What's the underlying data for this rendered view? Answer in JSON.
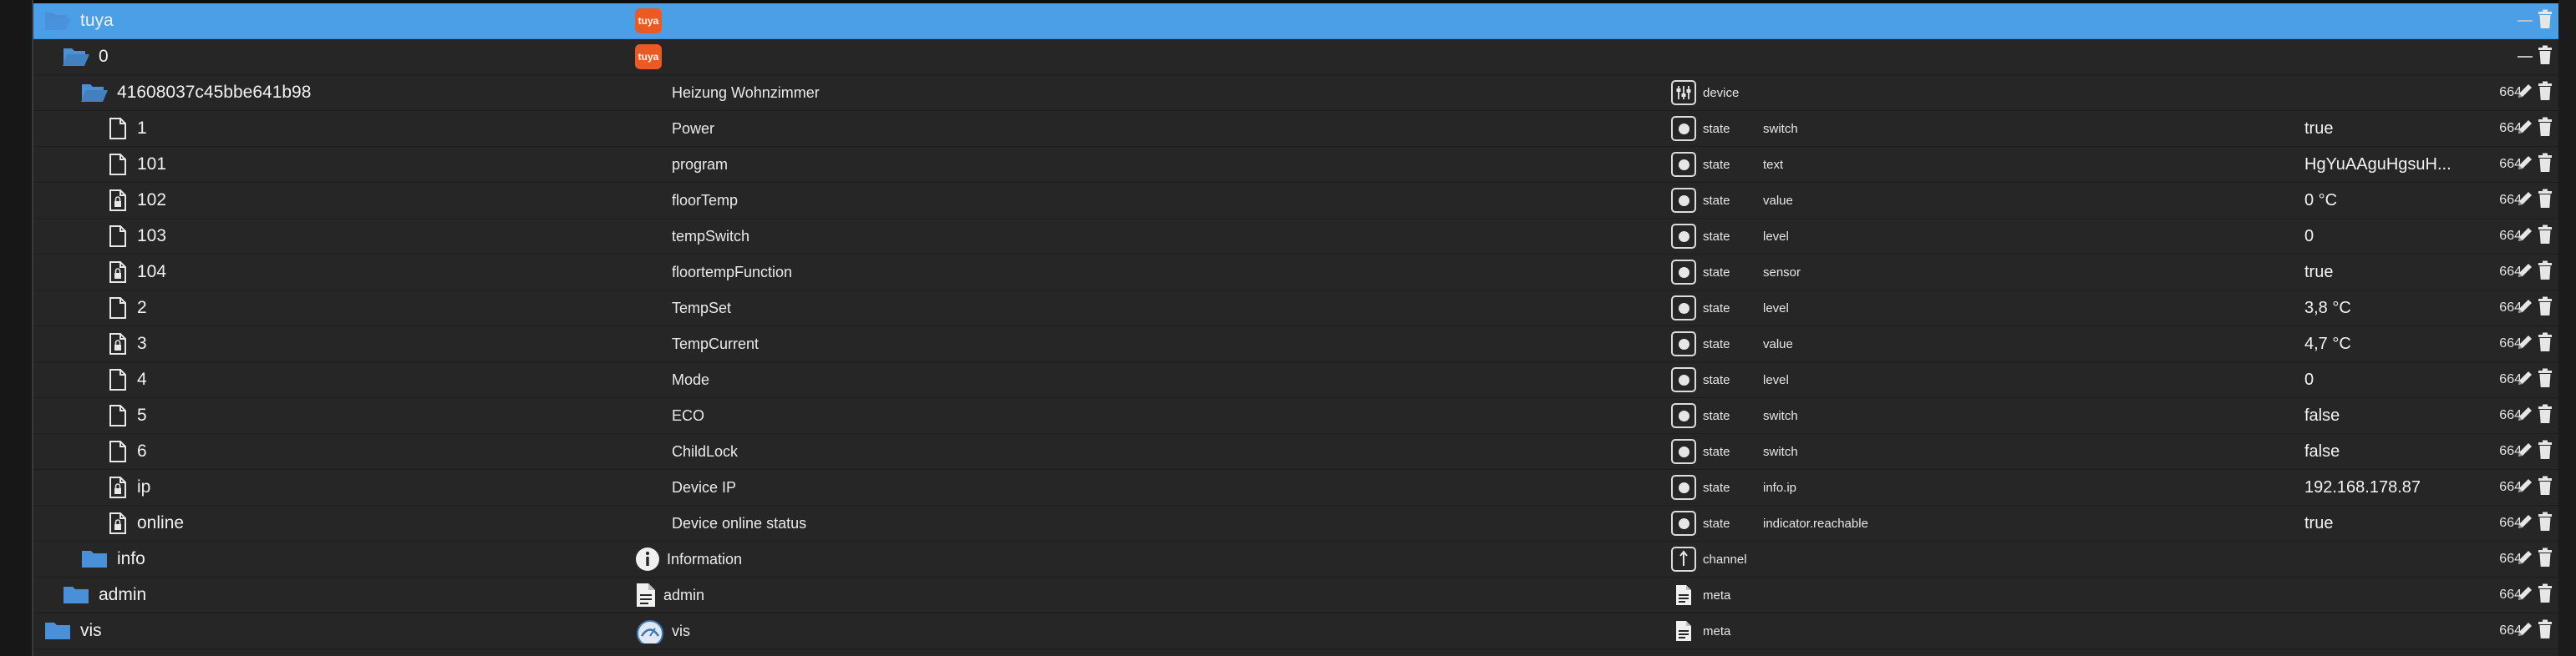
{
  "tree": {
    "rows": [
      {
        "id": "tuya",
        "name": "",
        "icon": "folder-open-icon",
        "badge": "tuya",
        "role": "",
        "type": "",
        "value": "",
        "acl": "",
        "selected": true,
        "level": 0
      },
      {
        "id": "0",
        "name": "",
        "icon": "folder-open-icon",
        "badge": "tuya",
        "role": "",
        "type": "",
        "value": "",
        "acl": "",
        "level": 1
      },
      {
        "id": "41608037c45bbe641b98",
        "name": "Heizung Wohnzimmer",
        "icon": "folder-open-icon",
        "role": "device",
        "role_icon": "device-icon",
        "type": "",
        "value": "",
        "acl": "664",
        "level": 2
      },
      {
        "id": "1",
        "name": "Power",
        "icon": "file-icon",
        "role": "state",
        "role_icon": "state-icon",
        "type": "switch",
        "value": "true",
        "acl": "664",
        "level": 3
      },
      {
        "id": "101",
        "name": "program",
        "icon": "file-icon",
        "role": "state",
        "role_icon": "state-icon",
        "type": "text",
        "value": "HgYuAAguHgsuH...",
        "acl": "664",
        "level": 3
      },
      {
        "id": "102",
        "name": "floorTemp",
        "icon": "file-lock-icon",
        "role": "state",
        "role_icon": "state-icon",
        "type": "value",
        "value": "0 °C",
        "acl": "664",
        "level": 3
      },
      {
        "id": "103",
        "name": "tempSwitch",
        "icon": "file-icon",
        "role": "state",
        "role_icon": "state-icon",
        "type": "level",
        "value": "0",
        "acl": "664",
        "level": 3
      },
      {
        "id": "104",
        "name": "floortempFunction",
        "icon": "file-lock-icon",
        "role": "state",
        "role_icon": "state-icon",
        "type": "sensor",
        "value": "true",
        "acl": "664",
        "level": 3
      },
      {
        "id": "2",
        "name": "TempSet",
        "icon": "file-icon",
        "role": "state",
        "role_icon": "state-icon",
        "type": "level",
        "value": "3,8 °C",
        "acl": "664",
        "level": 3
      },
      {
        "id": "3",
        "name": "TempCurrent",
        "icon": "file-lock-icon",
        "role": "state",
        "role_icon": "state-icon",
        "type": "value",
        "value": "4,7 °C",
        "acl": "664",
        "level": 3
      },
      {
        "id": "4",
        "name": "Mode",
        "icon": "file-icon",
        "role": "state",
        "role_icon": "state-icon",
        "type": "level",
        "value": "0",
        "acl": "664",
        "level": 3
      },
      {
        "id": "5",
        "name": "ECO",
        "icon": "file-icon",
        "role": "state",
        "role_icon": "state-icon",
        "type": "switch",
        "value": "false",
        "acl": "664",
        "level": 3
      },
      {
        "id": "6",
        "name": "ChildLock",
        "icon": "file-icon",
        "role": "state",
        "role_icon": "state-icon",
        "type": "switch",
        "value": "false",
        "acl": "664",
        "level": 3
      },
      {
        "id": "ip",
        "name": "Device IP",
        "icon": "file-lock-icon",
        "role": "state",
        "role_icon": "state-icon",
        "type": "info.ip",
        "value": "192.168.178.87",
        "acl": "664",
        "level": 3
      },
      {
        "id": "online",
        "name": "Device online status",
        "icon": "file-lock-icon",
        "role": "state",
        "role_icon": "state-icon",
        "type": "indicator.reachable",
        "value": "true",
        "acl": "664",
        "level": 3
      },
      {
        "id": "info",
        "name": "Information",
        "icon": "folder-icon",
        "name_icon": "info-icon",
        "role": "channel",
        "role_icon": "channel-icon",
        "type": "",
        "value": "",
        "acl": "664",
        "level": 2
      },
      {
        "id": "admin",
        "name": "admin",
        "icon": "folder-icon",
        "name_icon": "document-icon",
        "role": "meta",
        "role_icon": "meta-icon",
        "type": "",
        "value": "",
        "acl": "664",
        "level": 1
      },
      {
        "id": "vis",
        "name": "vis",
        "icon": "folder-icon",
        "name_icon": "vis-logo-icon",
        "role": "meta",
        "role_icon": "meta-icon",
        "type": "",
        "value": "",
        "acl": "664",
        "level": 0
      }
    ]
  },
  "colors": {
    "selected_row": "#4a9fe6",
    "tuya_badge": "#ec5a24",
    "folder": "#4a90d9",
    "background": "#262626"
  }
}
